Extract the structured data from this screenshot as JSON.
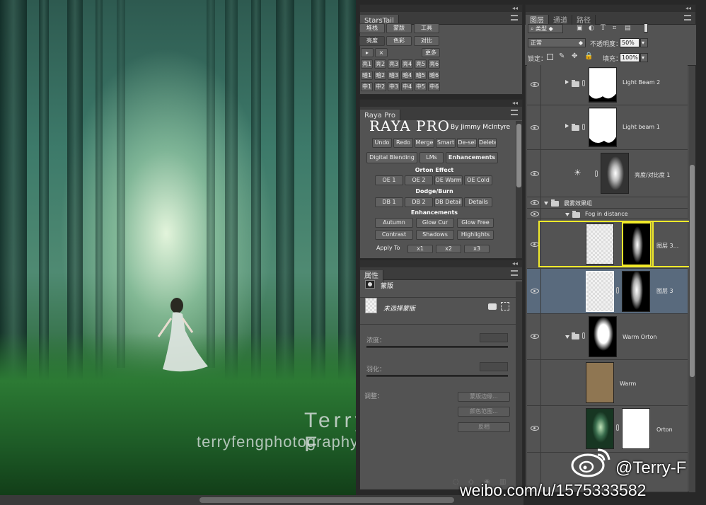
{
  "canvas": {
    "watermark_title": "Terry F",
    "watermark_url": "terryfengphotography.lofter.com"
  },
  "overlay": {
    "weibo_handle": "@Terry-F",
    "weibo_url": "weibo.com/u/1575333582"
  },
  "starstail": {
    "tab": "StarsTail",
    "row1": [
      "堆栈",
      "蒙版",
      "工具"
    ],
    "row2": [
      "亮度",
      "色彩",
      "对比"
    ],
    "more": "更多",
    "grid": [
      [
        "亮1",
        "亮2",
        "亮3",
        "亮4",
        "亮5",
        "亮6"
      ],
      [
        "暗1",
        "暗2",
        "暗3",
        "暗4",
        "暗5",
        "暗6"
      ],
      [
        "中1",
        "中2",
        "中3",
        "中4",
        "中5",
        "中6"
      ]
    ]
  },
  "raya": {
    "tab": "Raya Pro",
    "logo": "RAYA PRO",
    "byline": "By Jimmy McIntyre",
    "top_buttons": [
      "Undo",
      "Redo",
      "Merge",
      "Smart",
      "De-sel",
      "Delete"
    ],
    "tabs": [
      "Digital Blending",
      "LMs",
      "Enhancements"
    ],
    "orton_label": "Orton Effect",
    "orton_buttons": [
      "OE 1",
      "OE 2",
      "OE Warm",
      "OE Cold"
    ],
    "dodge_label": "Dodge/Burn",
    "dodge_buttons": [
      "DB 1",
      "DB 2",
      "DB Details",
      "Details"
    ],
    "enh_label": "Enhancements",
    "enh_row1": [
      "Autumn",
      "Glow Cur",
      "Glow Free"
    ],
    "enh_row2": [
      "Contrast",
      "Shadows",
      "Highlights"
    ],
    "apply_label": "Apply To",
    "apply_buttons": [
      "x1",
      "x2",
      "x3"
    ]
  },
  "properties": {
    "tab": "属性",
    "section": "蒙版",
    "mask_name": "未选择蒙版",
    "density_label": "浓度：",
    "feather_label": "羽化：",
    "adjust_label": "调整：",
    "btn_edge": "蒙版边缘...",
    "btn_color_range": "颜色范围...",
    "btn_invert": "反相"
  },
  "layers": {
    "tabs": [
      "图层",
      "通道",
      "路径"
    ],
    "filter_kind": "类型",
    "blend_mode": "正常",
    "opacity_label": "不透明度：",
    "opacity_value": "50%",
    "lock_label": "锁定：",
    "fill_label": "填充：",
    "fill_value": "100%",
    "items": [
      {
        "name": "Light Beam 2"
      },
      {
        "name": "Light beam 1"
      },
      {
        "name": "亮度/对比度 1"
      },
      {
        "name": "晨雾效果组"
      },
      {
        "name": "Fog in distance"
      },
      {
        "name": "图层 3..."
      },
      {
        "name": "图层 3"
      },
      {
        "name": "Warm Orton"
      },
      {
        "name": "Warm"
      },
      {
        "name": "Orton"
      }
    ]
  }
}
